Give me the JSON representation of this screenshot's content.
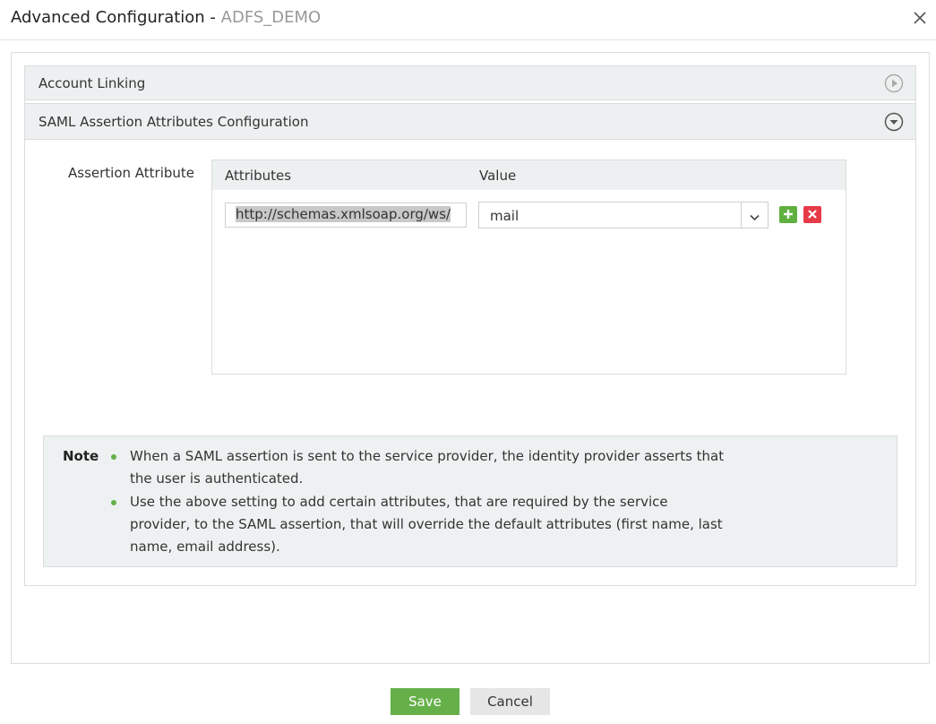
{
  "dialog": {
    "title": "Advanced Configuration -",
    "subtitle": "ADFS_DEMO"
  },
  "sections": [
    {
      "label": "Account Linking",
      "state": "collapsed",
      "icon": "play-circle-icon"
    },
    {
      "label": "SAML Assertion Attributes Configuration",
      "state": "expanded",
      "icon": "chevron-down-circle-icon"
    }
  ],
  "assertion": {
    "field_label": "Assertion Attribute",
    "columns": [
      "Attributes",
      "Value"
    ],
    "rows": [
      {
        "attribute": "http://schemas.xmlsoap.org/ws/",
        "value": "mail"
      }
    ]
  },
  "note": {
    "label": "Note",
    "items": [
      "When a SAML assertion is sent to the service provider, the identity provider asserts that the user is authenticated.",
      "Use the above setting to add certain attributes, that are required by the service provider, to the SAML assertion, that will override the default attributes (first name, last name, email address)."
    ]
  },
  "footer": {
    "save_label": "Save",
    "cancel_label": "Cancel"
  },
  "colors": {
    "primary_green": "#66b04a",
    "delete_red": "#e63b47",
    "panel_bg": "#edf0f0"
  }
}
